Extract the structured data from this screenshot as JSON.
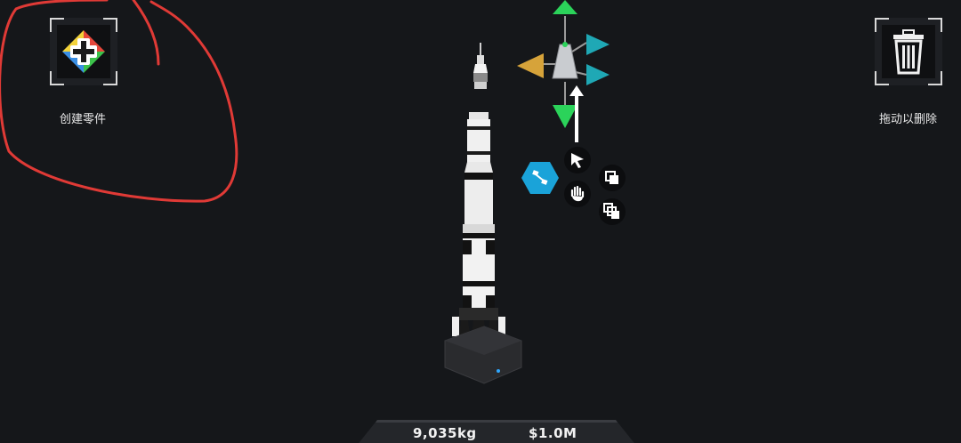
{
  "left_panel": {
    "create_part_label": "创建零件",
    "create_icon": "four-color-move-icon"
  },
  "right_panel": {
    "delete_label": "拖动以删除",
    "delete_icon": "trash-can-icon"
  },
  "tools": {
    "symmetry_icon": "hex-symmetry-icon",
    "select_icon": "cursor-arrow-icon",
    "pan_icon": "hand-icon",
    "clone_icon": "clone-layers-icon",
    "clone_all_icon": "clone-stack-icon",
    "gizmo": "translate-gizmo"
  },
  "status": {
    "mass": "9,035kg",
    "cost": "$1.0M"
  },
  "colors": {
    "background": "#15171a",
    "gizmo_green": "#2bd35a",
    "gizmo_cyan": "#1fa8b5",
    "gizmo_gold": "#d6a33a",
    "symmetry_blue": "#1aa3d9",
    "annotation_red": "#e03a36"
  }
}
